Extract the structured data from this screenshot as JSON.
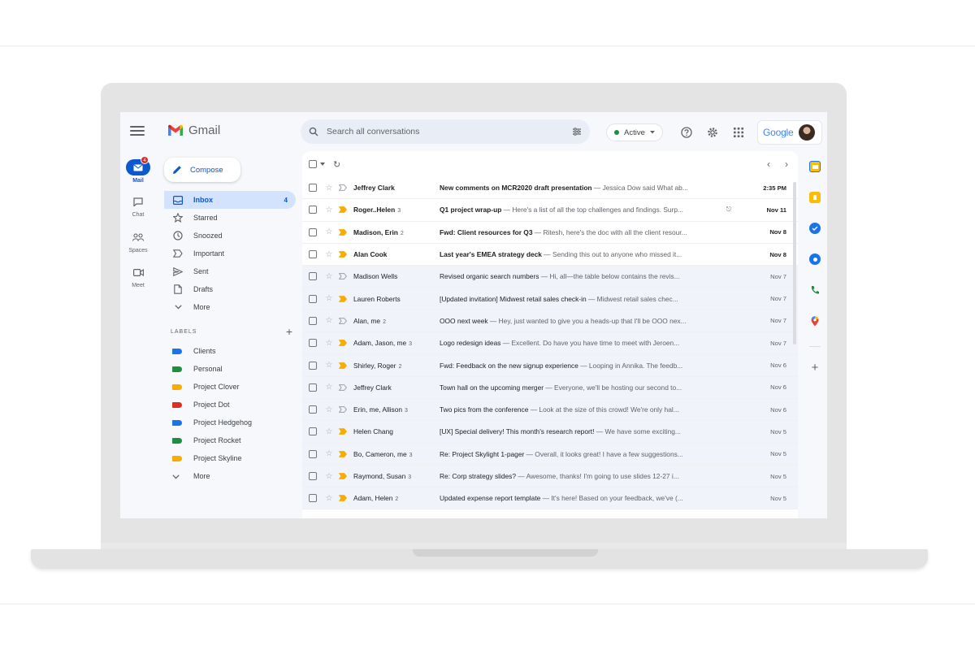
{
  "app": {
    "name": "Gmail"
  },
  "search": {
    "placeholder": "Search all conversations"
  },
  "status": {
    "label": "Active"
  },
  "header": {
    "google_word": "Google"
  },
  "rail": {
    "items": [
      {
        "label": "Mail",
        "icon": "mail-icon",
        "active": true,
        "badge": "4"
      },
      {
        "label": "Chat",
        "icon": "chat-icon"
      },
      {
        "label": "Spaces",
        "icon": "spaces-icon"
      },
      {
        "label": "Meet",
        "icon": "video-icon"
      }
    ]
  },
  "compose": {
    "label": "Compose"
  },
  "nav": {
    "items": [
      {
        "label": "Inbox",
        "icon": "inbox-icon",
        "count": "4",
        "active": true
      },
      {
        "label": "Starred",
        "icon": "star-icon"
      },
      {
        "label": "Snoozed",
        "icon": "clock-icon"
      },
      {
        "label": "Important",
        "icon": "important-icon"
      },
      {
        "label": "Sent",
        "icon": "send-icon"
      },
      {
        "label": "Drafts",
        "icon": "draft-icon"
      },
      {
        "label": "More",
        "icon": "chevron-down-icon"
      }
    ]
  },
  "labels": {
    "title": "LABELS",
    "items": [
      {
        "name": "Clients",
        "color": "#1a73e8"
      },
      {
        "name": "Personal",
        "color": "#1e8e3e"
      },
      {
        "name": "Project Clover",
        "color": "#f9ab00"
      },
      {
        "name": "Project Dot",
        "color": "#d93025"
      },
      {
        "name": "Project Hedgehog",
        "color": "#1a73e8"
      },
      {
        "name": "Project Rocket",
        "color": "#1e8e3e"
      },
      {
        "name": "Project Skyline",
        "color": "#f9ab00"
      }
    ],
    "more": "More"
  },
  "emails": [
    {
      "from": "Jeffrey Clark",
      "count": "",
      "subject": "New comments on MCR2020 draft presentation",
      "snippet": " — Jessica Dow said What ab...",
      "date": "2:35 PM",
      "unread": true,
      "important": false,
      "attachment": false
    },
    {
      "from": "Roger..Helen",
      "count": "3",
      "subject": "Q1 project wrap-up",
      "snippet": " — Here's a list of all the top challenges and findings. Surp...",
      "date": "Nov 11",
      "unread": true,
      "important": true,
      "attachment": true
    },
    {
      "from": "Madison, Erin",
      "count": "2",
      "subject": "Fwd: Client resources for Q3",
      "snippet": " — Ritesh, here's the doc with all the client resour...",
      "date": "Nov 8",
      "unread": true,
      "important": true,
      "attachment": false
    },
    {
      "from": "Alan Cook",
      "count": "",
      "subject": "Last year's EMEA strategy deck",
      "snippet": " — Sending this out to anyone who missed it...",
      "date": "Nov 8",
      "unread": true,
      "important": true,
      "attachment": false
    },
    {
      "from": "Madison Wells",
      "count": "",
      "subject": "Revised organic search numbers",
      "snippet": " — Hi, all—the table below contains the revis...",
      "date": "Nov 7",
      "unread": false,
      "important": false,
      "attachment": false
    },
    {
      "from": "Lauren Roberts",
      "count": "",
      "subject": "[Updated invitation] Midwest retail sales check-in",
      "snippet": " — Midwest retail sales chec...",
      "date": "Nov 7",
      "unread": false,
      "important": true,
      "attachment": false
    },
    {
      "from": "Alan, me",
      "count": "2",
      "subject": "OOO next week",
      "snippet": " — Hey, just wanted to give you a heads-up that I'll be OOO nex...",
      "date": "Nov 7",
      "unread": false,
      "important": false,
      "attachment": false
    },
    {
      "from": "Adam, Jason, me",
      "count": "3",
      "subject": "Logo redesign ideas",
      "snippet": " — Excellent. Do have you have time to meet with Jeroen...",
      "date": "Nov 7",
      "unread": false,
      "important": true,
      "attachment": false
    },
    {
      "from": "Shirley, Roger",
      "count": "2",
      "subject": "Fwd: Feedback on the new signup experience",
      "snippet": " — Looping in Annika. The feedb...",
      "date": "Nov 6",
      "unread": false,
      "important": true,
      "attachment": false
    },
    {
      "from": "Jeffrey Clark",
      "count": "",
      "subject": "Town hall on the upcoming merger",
      "snippet": " — Everyone, we'll be hosting our second to...",
      "date": "Nov 6",
      "unread": false,
      "important": false,
      "attachment": false
    },
    {
      "from": "Erin, me, Allison",
      "count": "3",
      "subject": "Two pics from the conference",
      "snippet": " — Look at the size of this crowd! We're only hal...",
      "date": "Nov 6",
      "unread": false,
      "important": false,
      "attachment": false
    },
    {
      "from": "Helen Chang",
      "count": "",
      "subject": "[UX] Special delivery! This month's research report!",
      "snippet": " — We have some exciting...",
      "date": "Nov 5",
      "unread": false,
      "important": true,
      "attachment": false
    },
    {
      "from": "Bo, Cameron, me",
      "count": "3",
      "subject": "Re: Project Skylight 1-pager",
      "snippet": " — Overall, it looks great! I have a few suggestions...",
      "date": "Nov 5",
      "unread": false,
      "important": true,
      "attachment": false
    },
    {
      "from": "Raymond, Susan",
      "count": "3",
      "subject": "Re: Corp strategy slides?",
      "snippet": " — Awesome, thanks! I'm going to use slides 12-27 i...",
      "date": "Nov 5",
      "unread": false,
      "important": true,
      "attachment": false
    },
    {
      "from": "Adam, Helen",
      "count": "2",
      "subject": "Updated expense report template",
      "snippet": " — It's here! Based on your feedback, we've (...",
      "date": "Nov 5",
      "unread": false,
      "important": true,
      "attachment": false
    }
  ],
  "side_panel": [
    {
      "icon": "calendar-icon",
      "color": "#1a73e8"
    },
    {
      "icon": "keep-icon",
      "color": "#fbbc04"
    },
    {
      "icon": "tasks-icon",
      "color": "#1a73e8"
    },
    {
      "icon": "contacts-icon",
      "color": "#1a73e8"
    },
    {
      "icon": "voice-icon",
      "color": "#1e8e3e"
    },
    {
      "icon": "maps-icon",
      "color": "#ea4335"
    }
  ],
  "colors": {
    "accent": "#0b57d0",
    "selected_nav": "#d3e3fd",
    "background": "#f6f8fc",
    "important": "#f9ab00"
  }
}
